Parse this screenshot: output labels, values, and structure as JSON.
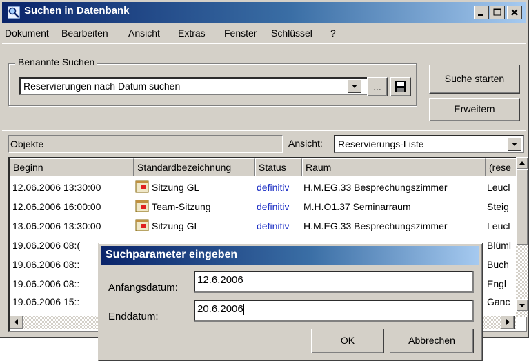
{
  "window": {
    "title": "Suchen in Datenbank"
  },
  "menu": [
    {
      "label": "Dokument"
    },
    {
      "label": "Bearbeiten"
    },
    {
      "label": "Ansicht"
    },
    {
      "label": "Extras"
    },
    {
      "label": "Fenster"
    },
    {
      "label": "Schlüssel"
    },
    {
      "label": "?"
    }
  ],
  "named_searches": {
    "group_label": "Benannte Suchen",
    "selected": "Reservierungen nach Datum suchen",
    "browse_label": "...",
    "start_button": "Suche starten",
    "extend_button": "Erweitern"
  },
  "objects": {
    "label": "Objekte",
    "view_label": "Ansicht:",
    "view_selected": "Reservierungs-Liste"
  },
  "table": {
    "columns": [
      "Beginn",
      "Standardbezeichnung",
      "Status",
      "Raum",
      "(rese"
    ],
    "rows": [
      {
        "beginn": "12.06.2006 13:30:00",
        "bezeichnung": "Sitzung GL",
        "status": "definitiv",
        "raum": "H.M.EG.33  Besprechungszimmer",
        "res": "Leucl"
      },
      {
        "beginn": "12.06.2006 16:00:00",
        "bezeichnung": "Team-Sitzung",
        "status": "definitiv",
        "raum": "M.H.O1.37  Seminarraum",
        "res": "Steig"
      },
      {
        "beginn": "13.06.2006 13:30:00",
        "bezeichnung": "Sitzung GL",
        "status": "definitiv",
        "raum": "H.M.EG.33  Besprechungszimmer",
        "res": "Leucl"
      },
      {
        "beginn": "19.06.2006 08:(",
        "bezeichnung": "",
        "status": "",
        "raum": "",
        "res": "Blüml"
      },
      {
        "beginn": "19.06.2006 08::",
        "bezeichnung": "",
        "status": "",
        "raum": "",
        "res": "Buch"
      },
      {
        "beginn": "19.06.2006 08::",
        "bezeichnung": "",
        "status": "",
        "raum": "",
        "res": "Engl"
      },
      {
        "beginn": "19.06.2006 15::",
        "bezeichnung": "",
        "status": "",
        "raum": "",
        "res": "Ganc"
      }
    ]
  },
  "dialog": {
    "title": "Suchparameter eingeben",
    "start_label": "Anfangsdatum:",
    "start_value": "12.6.2006",
    "end_label": "Enddatum:",
    "end_value": "20.6.2006",
    "ok_label": "OK",
    "cancel_label": "Abbrechen"
  },
  "colors": {
    "title_gradient_start": "#0a246a",
    "status_text": "#1c2fc4",
    "face": "#d4d0c8"
  }
}
